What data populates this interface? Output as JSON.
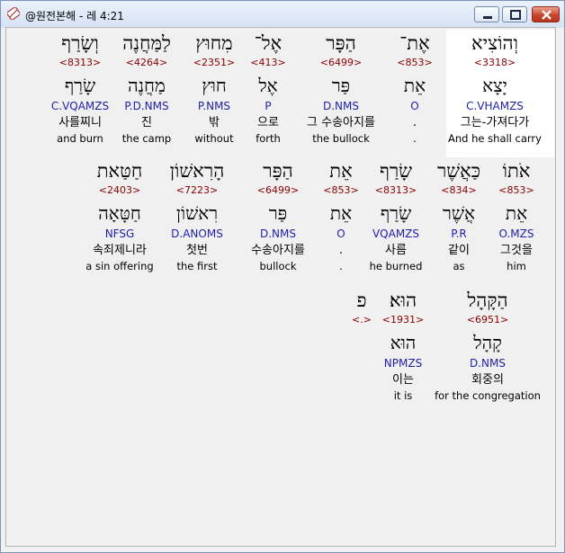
{
  "window": {
    "title": "@원전본해 - 레 4:21",
    "icon": "bible-app-icon",
    "buttons": [
      "minimize",
      "maximize",
      "close"
    ]
  },
  "colors": {
    "strongs": "#8b0000",
    "parse": "#1f1fa8",
    "highlight": "#ffffff"
  },
  "rows": [
    {
      "words": [
        {
          "heb": "וְהוֹצִיא",
          "num": "<3318>",
          "root": "יָצָא",
          "parse": "C.VHAMZS",
          "kor": "그는-가져다가",
          "eng": "And he shall carry",
          "selected": true
        },
        {
          "heb": "אֶת־",
          "num": "<853>",
          "root": "אֵת",
          "parse": "O",
          "kor": ".",
          "eng": "."
        },
        {
          "heb": "הַפָּר",
          "num": "<6499>",
          "root": "פַּר",
          "parse": "D.NMS",
          "kor": "그 수송아지를",
          "eng": "the bullock"
        },
        {
          "heb": "אֶל־",
          "num": "<413>",
          "root": "אֶל",
          "parse": "P",
          "kor": "으로",
          "eng": "forth"
        },
        {
          "heb": "מִחוּץ",
          "num": "<2351>",
          "root": "חוּץ",
          "parse": "P.NMS",
          "kor": "밖",
          "eng": "without"
        },
        {
          "heb": "לַמַּחֲנֶה",
          "num": "<4264>",
          "root": "מַחֲנֶה",
          "parse": "P.D.NMS",
          "kor": "진",
          "eng": "the camp"
        },
        {
          "heb": "וְשָׂרַף",
          "num": "<8313>",
          "root": "שָׂרַף",
          "parse": "C.VQAMZS",
          "kor": "사를찌니",
          "eng": "and burn"
        }
      ]
    },
    {
      "words": [
        {
          "heb": "אֹתוֹ",
          "num": "<853>",
          "root": "אֵת",
          "parse": "O.MZS",
          "kor": "그것을",
          "eng": "him"
        },
        {
          "heb": "כַּאֲשֶׁר",
          "num": "<834>",
          "root": "אֲשֶׁר",
          "parse": "P.R",
          "kor": "같이",
          "eng": "as"
        },
        {
          "heb": "שָׂרַף",
          "num": "<8313>",
          "root": "שָׂרַף",
          "parse": "VQAMZS",
          "kor": "사름",
          "eng": "he burned"
        },
        {
          "heb": "אֵת",
          "num": "<853>",
          "root": "אֵת",
          "parse": "O",
          "kor": ".",
          "eng": "."
        },
        {
          "heb": "הַפָּר",
          "num": "<6499>",
          "root": "פַּר",
          "parse": "D.NMS",
          "kor": "수송아지를",
          "eng": "bullock"
        },
        {
          "heb": "הָרִאשׁוֹן",
          "num": "<7223>",
          "root": "רִאשׁוֹן",
          "parse": "D.ANOMS",
          "kor": "첫번",
          "eng": "the first"
        },
        {
          "heb": "חַטַּאת",
          "num": "<2403>",
          "root": "חַטָּאָה",
          "parse": "NFSG",
          "kor": "속죄제니라",
          "eng": "a sin offering"
        }
      ]
    },
    {
      "words": [
        {
          "heb": "הַקָּהָל",
          "num": "<6951>",
          "root": "קָהָל",
          "parse": "D.NMS",
          "kor": "회중의",
          "eng": "for the congregation"
        },
        {
          "heb": "הוּא׃",
          "num": "<1931>",
          "root": "הוּא",
          "parse": "NPMZS",
          "kor": "이는",
          "eng": "it is"
        },
        {
          "heb": "פ",
          "num": "<.>",
          "root": "",
          "parse": "",
          "kor": "",
          "eng": ""
        }
      ]
    }
  ]
}
